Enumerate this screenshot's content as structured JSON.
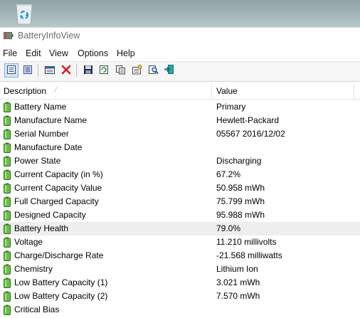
{
  "window": {
    "title": "BatteryInfoView"
  },
  "menu": [
    "File",
    "Edit",
    "View",
    "Options",
    "Help"
  ],
  "toolbar": {
    "buttons": [
      {
        "icon": "html-report-icon"
      },
      {
        "icon": "html-report-all-icon"
      },
      {
        "icon": "properties-window-icon"
      },
      {
        "icon": "close-x-icon"
      },
      {
        "icon": "save-icon"
      },
      {
        "icon": "refresh-icon"
      },
      {
        "icon": "copy-icon"
      },
      {
        "icon": "properties-icon"
      },
      {
        "icon": "find-icon"
      },
      {
        "icon": "exit-icon"
      }
    ]
  },
  "list": {
    "columns": {
      "description": "Description",
      "value": "Value"
    },
    "sort_indicator": "⁄",
    "selected_index": 9,
    "rows": [
      {
        "description": "Battery Name",
        "value": "Primary"
      },
      {
        "description": "Manufacture Name",
        "value": "Hewlett-Packard"
      },
      {
        "description": "Serial Number",
        "value": "05567 2016/12/02"
      },
      {
        "description": "Manufacture Date",
        "value": ""
      },
      {
        "description": "Power State",
        "value": "Discharging"
      },
      {
        "description": "Current Capacity (in %)",
        "value": "67.2%"
      },
      {
        "description": "Current Capacity Value",
        "value": "50.958 mWh"
      },
      {
        "description": "Full Charged Capacity",
        "value": "75.799 mWh"
      },
      {
        "description": "Designed Capacity",
        "value": "95.988 mWh"
      },
      {
        "description": "Battery Health",
        "value": "79.0%"
      },
      {
        "description": "Voltage",
        "value": "11.210 millivolts"
      },
      {
        "description": "Charge/Discharge Rate",
        "value": "-21.568 milliwatts"
      },
      {
        "description": "Chemistry",
        "value": "Lithium Ion"
      },
      {
        "description": "Low Battery Capacity (1)",
        "value": "3.021 mWh"
      },
      {
        "description": "Low Battery Capacity (2)",
        "value": "7.570 mWh"
      },
      {
        "description": "Critical Bias",
        "value": ""
      }
    ]
  }
}
